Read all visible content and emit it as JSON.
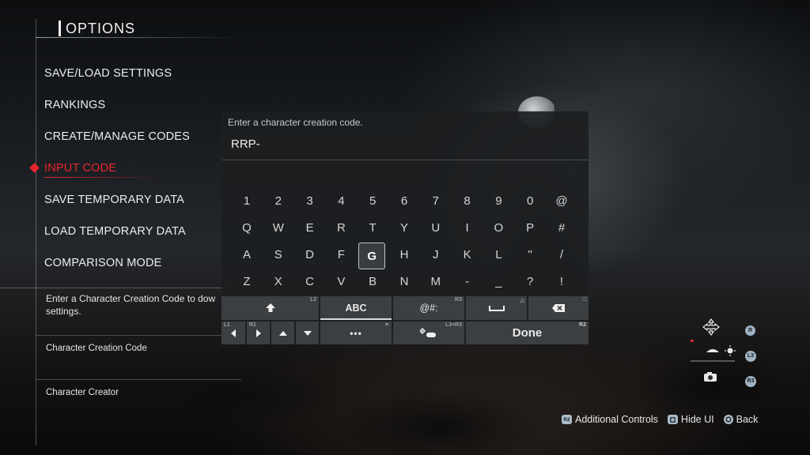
{
  "options": {
    "title": "OPTIONS",
    "menu": [
      {
        "label": "SAVE/LOAD SETTINGS"
      },
      {
        "label": "RANKINGS"
      },
      {
        "label": "CREATE/MANAGE CODES"
      },
      {
        "label": "INPUT CODE",
        "active": true
      },
      {
        "label": "SAVE TEMPORARY DATA"
      },
      {
        "label": "LOAD TEMPORARY DATA"
      },
      {
        "label": "COMPARISON MODE"
      }
    ],
    "description_lines": [
      "Enter a Character Creation Code to dow",
      "settings."
    ],
    "sub_items": [
      "Character Creation Code",
      "Character Creator"
    ]
  },
  "dialog": {
    "prompt": "Enter a character creation code.",
    "value": "RRP-",
    "keys": [
      [
        "1",
        "2",
        "3",
        "4",
        "5",
        "6",
        "7",
        "8",
        "9",
        "0",
        "@"
      ],
      [
        "Q",
        "W",
        "E",
        "R",
        "T",
        "Y",
        "U",
        "I",
        "O",
        "P",
        "#"
      ],
      [
        "A",
        "S",
        "D",
        "F",
        "G",
        "H",
        "J",
        "K",
        "L",
        "\"",
        "/"
      ],
      [
        "Z",
        "X",
        "C",
        "V",
        "B",
        "N",
        "M",
        "-",
        "_",
        "?",
        "!"
      ]
    ],
    "focused_key": "G",
    "bottom": {
      "shift_icon": "shift-icon",
      "shift_tag": "L2",
      "abc_label": "ABC",
      "symbols_label": "@#:",
      "symbols_tag": "R3",
      "space_tag": "△",
      "backspace_tag": "□",
      "left_tag": "L1",
      "right_tag": "R1",
      "more_label": "•••",
      "more_tag": "≡",
      "gamepad_tag": "L3+R3",
      "done_label": "Done",
      "done_tag": "R2"
    }
  },
  "hud": {
    "r_badge": "R",
    "l3_badge": "L3",
    "r3_badge": "R3"
  },
  "footer": {
    "r2_badge": "R2",
    "additional_controls": "Additional Controls",
    "hide_ui": "Hide UI",
    "back": "Back"
  },
  "colors": {
    "accent_red": "#e8262f",
    "key_bar": "#3e4145",
    "badge_blue": "#a9bccb"
  }
}
